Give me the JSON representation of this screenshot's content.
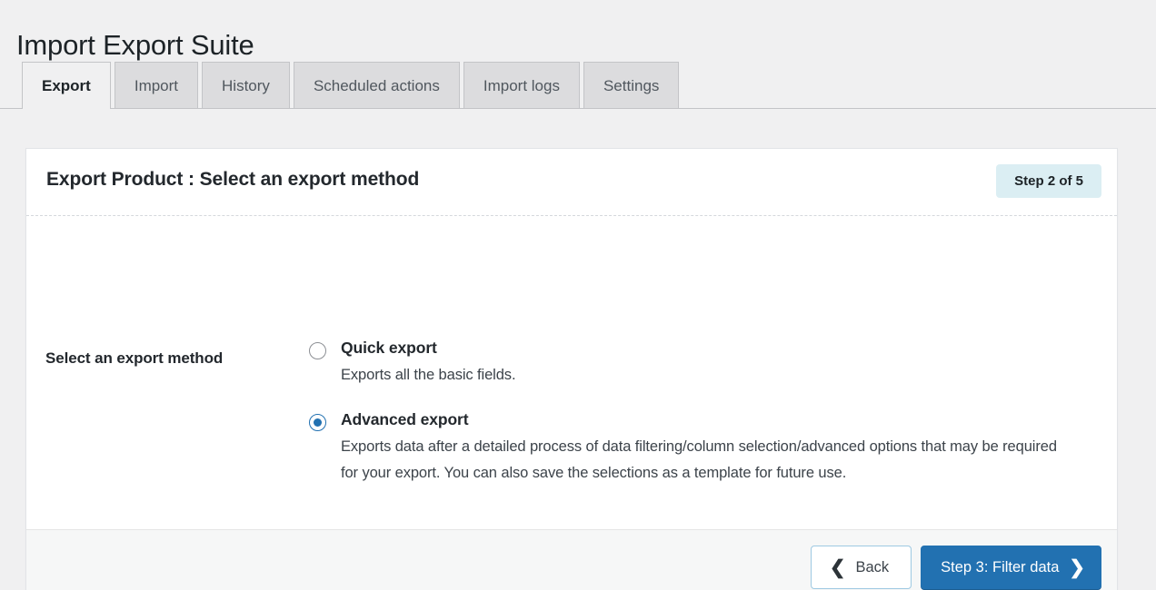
{
  "page": {
    "title": "Import Export Suite"
  },
  "tabs": [
    {
      "label": "Export",
      "active": true
    },
    {
      "label": "Import",
      "active": false
    },
    {
      "label": "History",
      "active": false
    },
    {
      "label": "Scheduled actions",
      "active": false
    },
    {
      "label": "Import logs",
      "active": false
    },
    {
      "label": "Settings",
      "active": false
    }
  ],
  "card": {
    "title": "Export Product : Select an export method",
    "step_badge": "Step 2 of 5"
  },
  "form": {
    "field_label": "Select an export method",
    "options": [
      {
        "title": "Quick export",
        "description": "Exports all the basic fields.",
        "selected": false
      },
      {
        "title": "Advanced export",
        "description": "Exports data after a detailed process of data filtering/column selection/advanced options that may be required for your export. You can also save the selections as a template for future use.",
        "selected": true
      }
    ]
  },
  "footer": {
    "back_label": "Back",
    "back_icon": "chevron-left-icon",
    "next_label": "Step 3: Filter data",
    "next_icon": "chevron-right-icon"
  },
  "colors": {
    "page_background": "#f0f0f1",
    "card_background": "#ffffff",
    "primary": "#2271b1",
    "badge_background": "#dbeef3",
    "tab_inactive": "#dcdcde",
    "footer_background": "#f6f7f7",
    "text": "#1d2327"
  }
}
